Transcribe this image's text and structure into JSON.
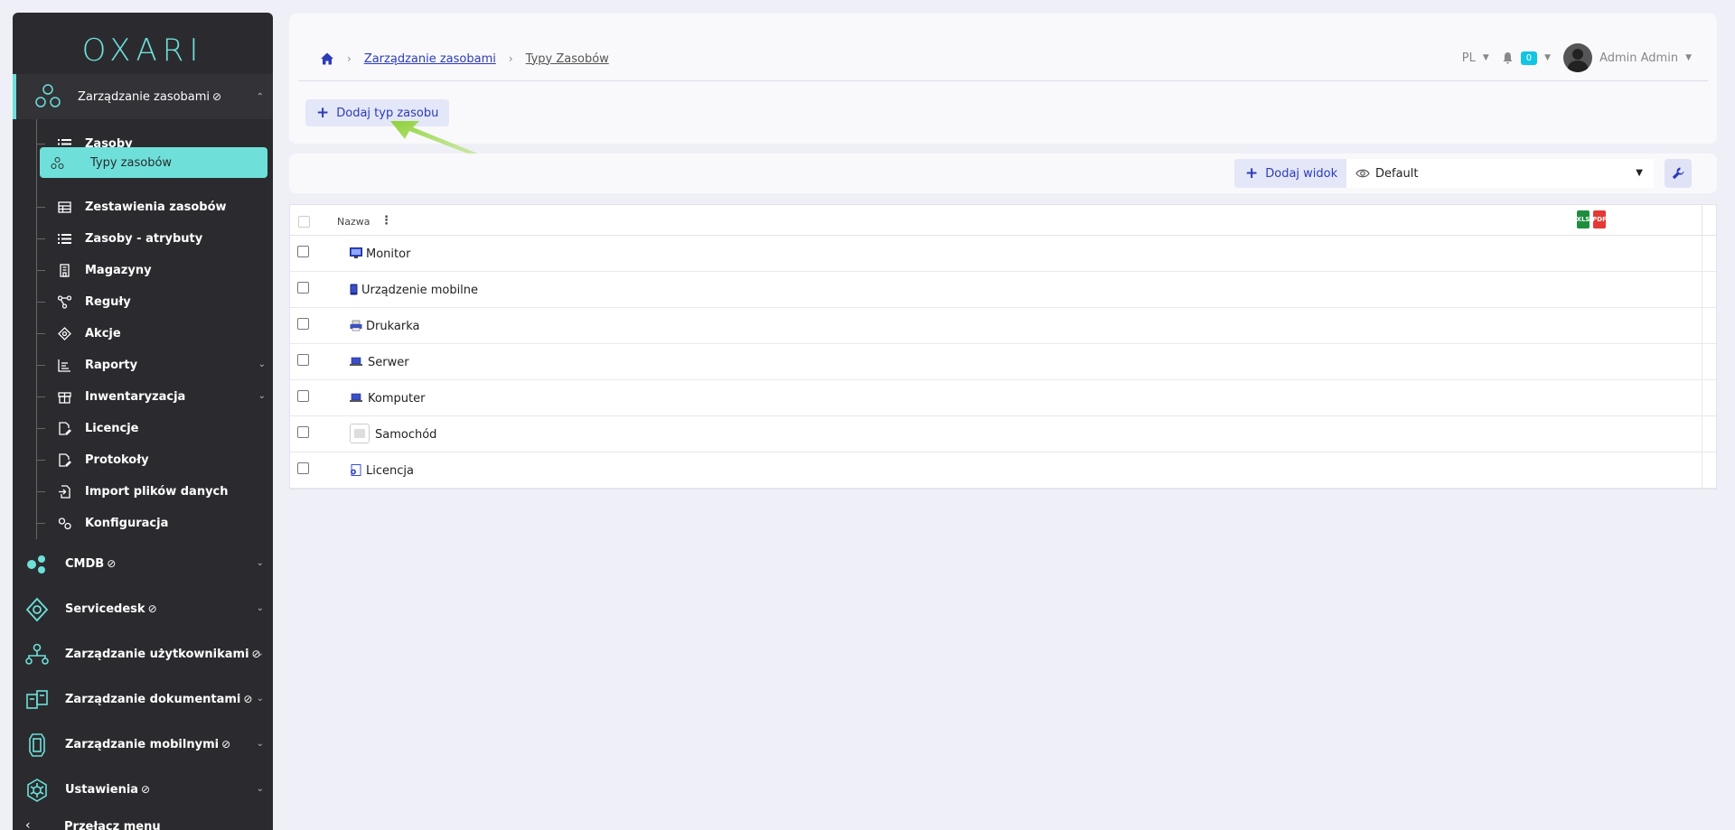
{
  "app": {
    "logo": "OXARI"
  },
  "sidebar": {
    "main_section": {
      "label": "Zarządzanie zasobami",
      "suffix": "⊘"
    },
    "items": [
      {
        "label": "Zasoby",
        "icon": "list-icon",
        "active": false
      },
      {
        "label": "Typy zasobów",
        "icon": "nodes-icon",
        "active": true
      },
      {
        "label": "Zestawienia zasobów",
        "icon": "table-icon",
        "active": false
      },
      {
        "label": "Zasoby - atrybuty",
        "icon": "list-icon",
        "active": false
      },
      {
        "label": "Magazyny",
        "icon": "building-icon",
        "active": false
      },
      {
        "label": "Reguły",
        "icon": "graph-icon",
        "active": false
      },
      {
        "label": "Akcje",
        "icon": "target-icon",
        "active": false
      },
      {
        "label": "Raporty",
        "icon": "chart-icon",
        "active": false,
        "expandable": true
      },
      {
        "label": "Inwentaryzacja",
        "icon": "box-icon",
        "active": false,
        "expandable": true
      },
      {
        "label": "Licencje",
        "icon": "doc-edit-icon",
        "active": false
      },
      {
        "label": "Protokoły",
        "icon": "doc-edit-icon",
        "active": false
      },
      {
        "label": "Import plików danych",
        "icon": "import-icon",
        "active": false
      },
      {
        "label": "Konfiguracja",
        "icon": "gears-icon",
        "active": false
      }
    ],
    "sections": [
      {
        "label": "CMDB",
        "suffix": "⊘",
        "icon": "cmdb-icon"
      },
      {
        "label": "Servicedesk",
        "suffix": "⊘",
        "icon": "servicedesk-icon"
      },
      {
        "label": "Zarządzanie użytkownikami",
        "suffix": "⊘",
        "icon": "users-icon"
      },
      {
        "label": "Zarządzanie dokumentami",
        "suffix": "⊘",
        "icon": "documents-icon"
      },
      {
        "label": "Zarządzanie mobilnymi",
        "suffix": "⊘",
        "icon": "mobile-icon"
      },
      {
        "label": "Ustawienia",
        "suffix": "⊘",
        "icon": "settings-icon"
      }
    ],
    "toggle_label": "Przełącz menu"
  },
  "header": {
    "breadcrumb": [
      "Zarządzanie zasobami",
      "Typy Zasobów"
    ],
    "language": "PL",
    "notifications": "0",
    "user": "Admin Admin",
    "add_type_label": "Dodaj typ zasobu"
  },
  "toolbar": {
    "add_view_label": "Dodaj widok",
    "view_selected": "Default"
  },
  "table": {
    "columns": [
      "Nazwa"
    ],
    "rows": [
      {
        "name": "Monitor",
        "icon": "monitor-icon"
      },
      {
        "name": "Urządzenie mobilne",
        "icon": "phone-icon"
      },
      {
        "name": "Drukarka",
        "icon": "printer-icon"
      },
      {
        "name": "Serwer",
        "icon": "laptop-icon"
      },
      {
        "name": "Komputer",
        "icon": "laptop-icon"
      },
      {
        "name": "Samochód",
        "icon": "image-placeholder-icon"
      },
      {
        "name": "Licencja",
        "icon": "license-icon"
      }
    ],
    "export": [
      "XLS",
      "PDF"
    ]
  },
  "colors": {
    "accent": "#6ee0d9",
    "link": "#2d3bb8",
    "sidebar": "#2b2b2f",
    "annotation_arrow": "#8ed13a"
  }
}
